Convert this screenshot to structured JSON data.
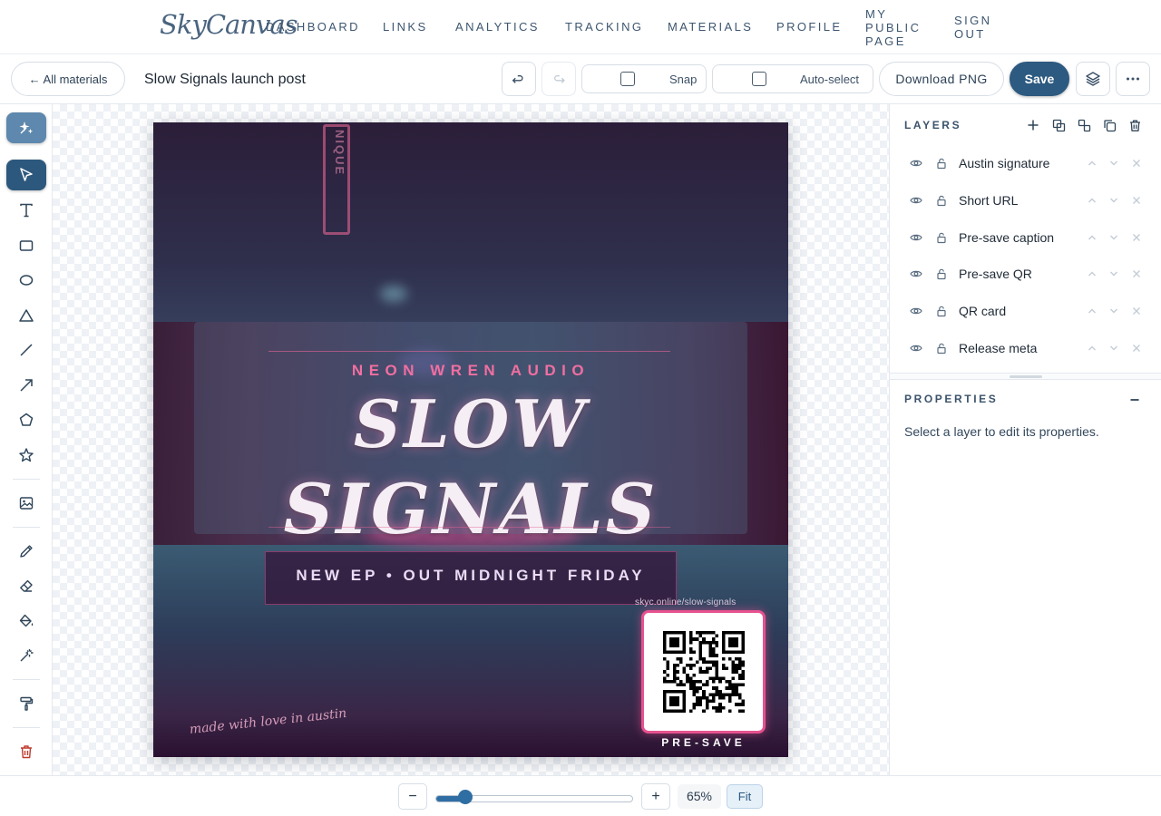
{
  "nav": {
    "brand": "SkyCanvas",
    "links": [
      "DASHBOARD",
      "LINKS",
      "ANALYTICS",
      "TRACKING",
      "MATERIALS",
      "PROFILE"
    ],
    "public_page": [
      "MY",
      "PUBLIC",
      "PAGE"
    ],
    "sign_out": [
      "SIGN",
      "OUT"
    ]
  },
  "toolbar": {
    "back_label": "← All materials",
    "doc_title": "Slow Signals launch post",
    "undo_icon": "undo-icon",
    "redo_icon": "redo-icon",
    "snap_label": "Snap",
    "snap_checked": false,
    "autoselect_label": "Auto-select",
    "autoselect_checked": false,
    "download_label": "Download PNG",
    "save_label": "Save",
    "save_color": "#2d5a80"
  },
  "tools": [
    "ai-magic",
    "select",
    "text",
    "rectangle",
    "ellipse",
    "triangle",
    "line",
    "arrow",
    "pentagon",
    "star",
    "image",
    "pencil",
    "eraser",
    "fill-bucket",
    "magic-wand",
    "paint-roller",
    "trash"
  ],
  "poster": {
    "brand_line": "NEON WREN AUDIO",
    "title_line1": "SLOW",
    "title_line2": "SIGNALS",
    "subtitle": "NEW EP • OUT MIDNIGHT FRIDAY",
    "short_url": "skyc.online/slow-signals",
    "qr_caption": "PRE-SAVE",
    "signature": "made with love in austin",
    "accent": "#e6528f",
    "sign_text": "NIQUE"
  },
  "layers": {
    "title": "LAYERS",
    "items": [
      "Austin signature",
      "Short URL",
      "Pre-save caption",
      "Pre-save QR",
      "QR card",
      "Release meta"
    ]
  },
  "properties": {
    "title": "PROPERTIES",
    "empty_text": "Select a layer to edit its properties."
  },
  "zoom": {
    "minus": "−",
    "plus": "+",
    "value_text": "65%",
    "level_fraction": 0.15,
    "fit_label": "Fit"
  }
}
